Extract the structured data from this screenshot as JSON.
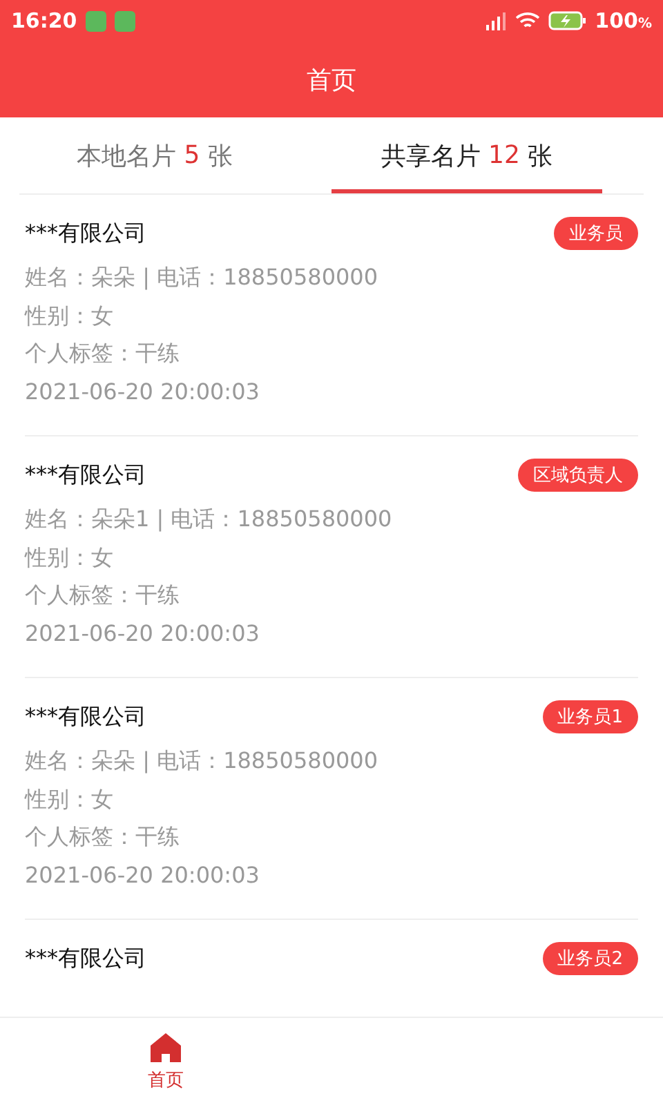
{
  "status_bar": {
    "time": "16:20",
    "battery_level_text": "100",
    "battery_unit": "%"
  },
  "header": {
    "title": "首页"
  },
  "tabs": [
    {
      "label": "本地名片",
      "count": "5",
      "unit": "张",
      "selected": false
    },
    {
      "label": "共享名片",
      "count": "12",
      "unit": "张",
      "selected": true
    }
  ],
  "cards": [
    {
      "company": "***有限公司",
      "badge": "业务员",
      "lines": [
        "姓名：朵朵 | 电话：18850580000",
        "性别：女",
        "个人标签：干练",
        "2021-06-20 20:00:03"
      ]
    },
    {
      "company": "***有限公司",
      "badge": "区域负责人",
      "lines": [
        "姓名：朵朵1 | 电话：18850580000",
        "性别：女",
        "个人标签：干练",
        "2021-06-20 20:00:03"
      ]
    },
    {
      "company": "***有限公司",
      "badge": "业务员1",
      "lines": [
        "姓名：朵朵 | 电话：18850580000",
        "性别：女",
        "个人标签：干练",
        "2021-06-20 20:00:03"
      ]
    },
    {
      "company": "***有限公司",
      "badge": "业务员2"
    }
  ],
  "bottom_nav": [
    {
      "label": "首页",
      "selected": true
    }
  ]
}
